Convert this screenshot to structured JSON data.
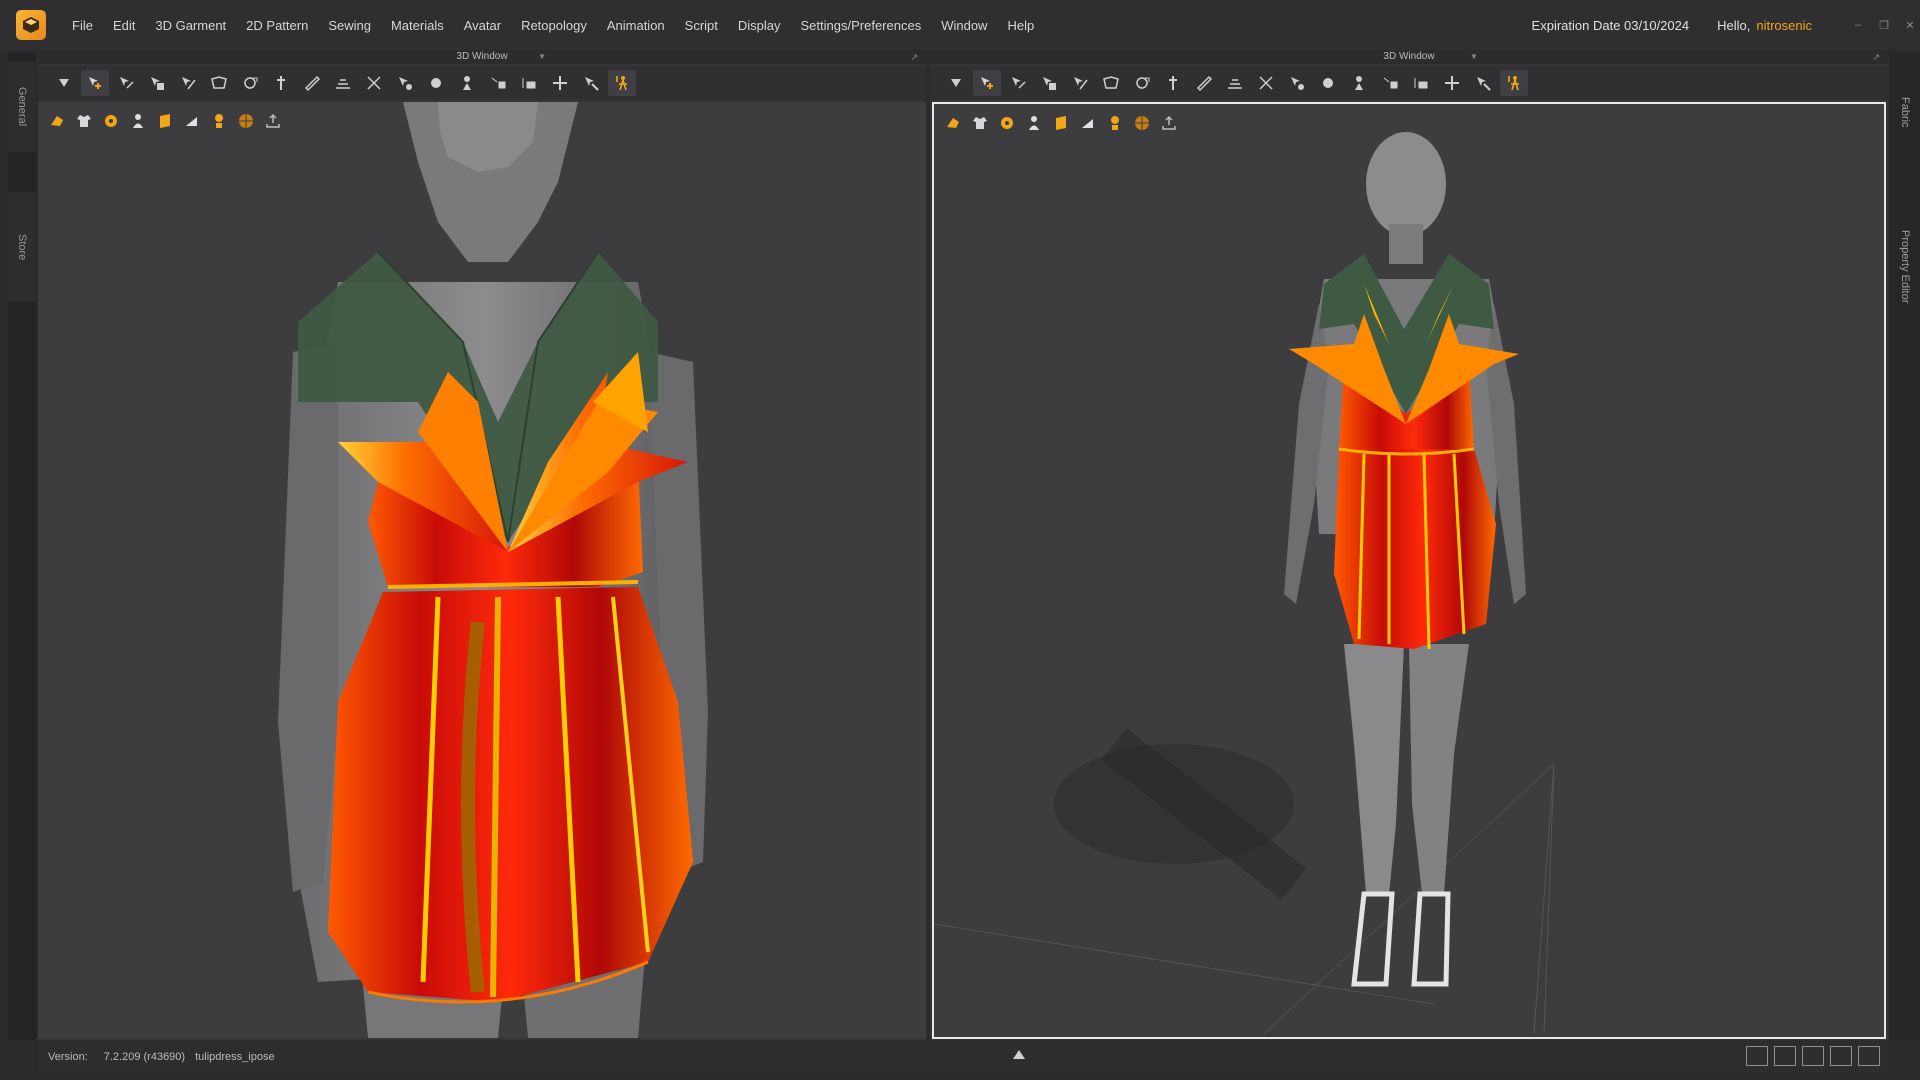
{
  "menu": {
    "items": [
      "File",
      "Edit",
      "3D Garment",
      "2D Pattern",
      "Sewing",
      "Materials",
      "Avatar",
      "Retopology",
      "Animation",
      "Script",
      "Display",
      "Settings/Preferences",
      "Window",
      "Help"
    ],
    "expiration": "Expiration Date 03/10/2024",
    "hello": "Hello,",
    "username": "nitrosenic"
  },
  "side_tabs": {
    "left": [
      "General",
      "Store"
    ],
    "right": [
      "Fabric",
      "Property Editor"
    ]
  },
  "panes": {
    "left": {
      "title": "3D Window"
    },
    "right": {
      "title": "3D Window"
    }
  },
  "toolbar_icons": [
    "select-move-icon",
    "transform-icon",
    "edit-pattern-icon",
    "fold-icon",
    "tack-icon",
    "pin-icon",
    "fold-arrange-icon",
    "steam-icon",
    "measure-icon",
    "stitch-icon",
    "trim-icon",
    "avatar-arrangement-icon",
    "button-icon",
    "buttonhole-icon",
    "zipper-icon",
    "topstitch-icon",
    "puckering-icon",
    "fitting-suit-icon",
    "simulation-icon"
  ],
  "viewport_icons": [
    "garment-view-icon",
    "shirt-icon",
    "texture-icon",
    "avatar-icon",
    "pattern-icon",
    "surface-icon",
    "skin-icon",
    "grid-globe-icon",
    "upload-icon"
  ],
  "status": {
    "version_label": "Version:",
    "version": "7.2.209 (r43690)",
    "file": "tulipdress_ipose"
  },
  "colors": {
    "accent": "#f2a516",
    "dress_red": "#d8140c",
    "dress_orange": "#ff6a00",
    "bodice_green": "#3f5a43"
  }
}
